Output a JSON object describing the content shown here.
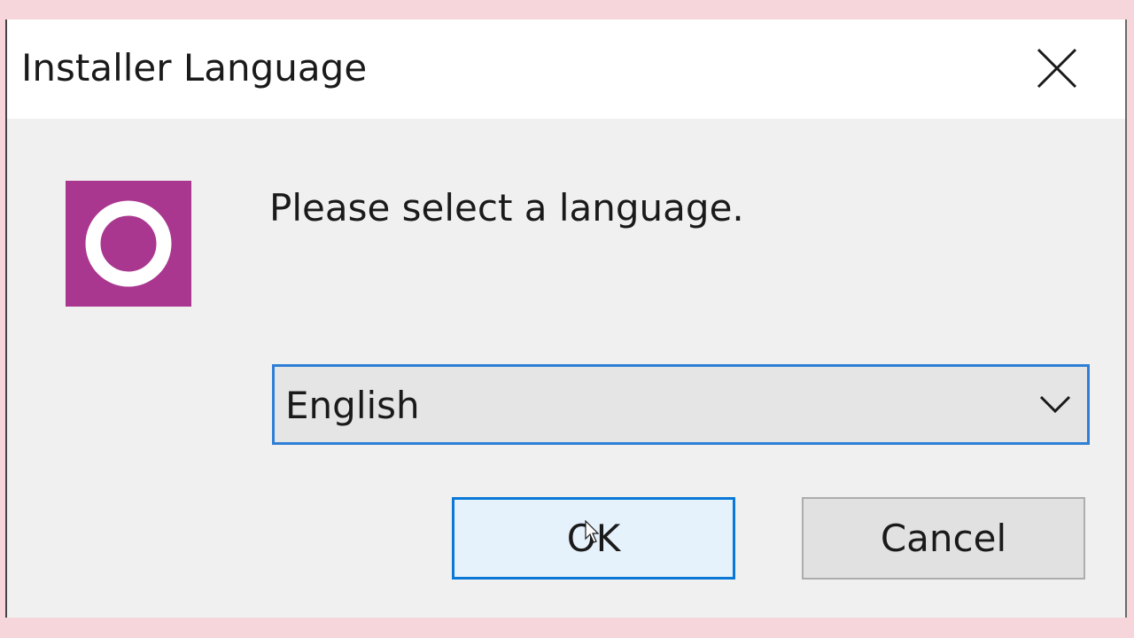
{
  "dialog": {
    "title": "Installer Language",
    "prompt": "Please select a language.",
    "language_select": {
      "selected": "English"
    },
    "ok_label": "OK",
    "cancel_label": "Cancel",
    "icons": {
      "close": "close-icon",
      "app": "app-logo-icon",
      "dropdown": "chevron-down-icon"
    }
  },
  "colors": {
    "background": "#f6d6da",
    "window": "#f0f0f0",
    "titlebar": "#ffffff",
    "app_icon": "#a9378f",
    "focus_border": "#0a78d7",
    "ok_fill": "#e5f1fb",
    "cancel_fill": "#e1e1e1"
  }
}
